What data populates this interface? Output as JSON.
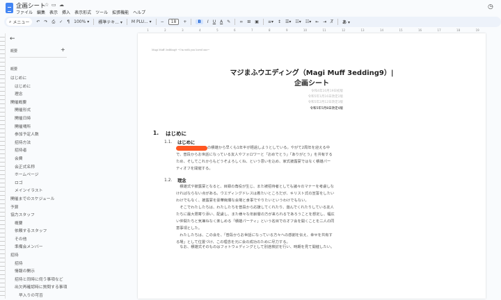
{
  "app": {
    "title": "企画シート",
    "menus": [
      "ファイル",
      "編集",
      "表示",
      "挿入",
      "表示形式",
      "ツール",
      "拡張機能",
      "ヘルプ"
    ]
  },
  "toolbar": {
    "search": "メニュー",
    "zoom": "100%",
    "style": "標準テキ...",
    "font": "M PLU...",
    "font_size": "18",
    "bold": "B",
    "italic": "I",
    "underline": "U",
    "text_color": "A",
    "input_tools": "あ"
  },
  "ruler": [
    "1",
    "2",
    "3",
    "4",
    "5",
    "6",
    "7",
    "8",
    "9",
    "10",
    "11",
    "12",
    "13",
    "14",
    "15",
    "16",
    "17",
    "18",
    "19"
  ],
  "sidebar": {
    "title": "概要",
    "outline_label": "概要",
    "items": [
      {
        "label": "はじめに",
        "level": 1
      },
      {
        "label": "はじめに",
        "level": 2
      },
      {
        "label": "理念",
        "level": 2
      },
      {
        "label": "開催概要",
        "level": 1
      },
      {
        "label": "開催形式",
        "level": 2
      },
      {
        "label": "開催日時",
        "level": 2
      },
      {
        "label": "開催場所",
        "level": 2
      },
      {
        "label": "参加予定人数",
        "level": 2
      },
      {
        "label": "招待方法",
        "level": 2
      },
      {
        "label": "招待者",
        "level": 2
      },
      {
        "label": "会費",
        "level": 2
      },
      {
        "label": "会正式名称",
        "level": 2
      },
      {
        "label": "ホームページ",
        "level": 2
      },
      {
        "label": "ロゴ",
        "level": 2
      },
      {
        "label": "メインイラスト",
        "level": 2
      },
      {
        "label": "開催までのスケジュール",
        "level": 1
      },
      {
        "label": "予算",
        "level": 1
      },
      {
        "label": "協力スタッフ",
        "level": 1
      },
      {
        "label": "概要",
        "level": 2
      },
      {
        "label": "依頼するスタッフ",
        "level": 2
      },
      {
        "label": "その他",
        "level": 2
      },
      {
        "label": "準備会メンバー",
        "level": 2
      },
      {
        "label": "招待",
        "level": 1
      },
      {
        "label": "招待",
        "level": 2
      },
      {
        "label": "情報の開示",
        "level": 2
      },
      {
        "label": "招待と同時に伺う事項など",
        "level": 2
      },
      {
        "label": "出欠再確認時に質問する事項",
        "level": 2
      },
      {
        "label": "早入りの可否",
        "level": 3
      }
    ]
  },
  "doc": {
    "header": "Magi Muff 3edding9 ~I'm with you loved one~",
    "title1": "マジまふウエディング（Magi Muff 3edding9）|",
    "title2": "企画シート",
    "dates": [
      "令和4年10月19日初版",
      "令和5年1月16日改定2版",
      "令和5年2月12日改定3版",
      "令和5年5月8日改定4版"
    ],
    "s1_num": "1.",
    "s1": "はじめに",
    "s11_num": "1.1.",
    "s11": "はじめに",
    "s11_lines": [
      "の積雄から早くも1年半が経過しようとしている。やがて2周年を迎える中",
      "で、普段からお世話になっている友人やフォロワーと「おめでとう」「ありがとう」を共有する",
      "ため、そしてこれからもどうぞよろしくね、という思いを込め、家式披露宴ではなく積雄パー",
      "ティオフを開催する。"
    ],
    "s12_num": "1.2.",
    "s12": "理念",
    "s12_lines": [
      "　積雄式や披露宴となると、目録の角役が生じ、また被招待者としても諸々のマナーを考慮しな",
      "ければならない点がある。ウエディングドレスは着たいところだが、キリスト式の宣誓をしたい",
      "わけでもなく、披露宴を豪華絢爛な会場と食事でやりたいというわけでもない。",
      "　そこでわたしたちは、わたしたちを普段から応援してくれたり、遊んでくれたりしている友人",
      "たちに最大限寄り添い、配慮し、また様々な年齢層の方が来られるであろうことを想定し、幅広",
      "い仲間たちと気兼ねなく楽しめる「積雄パーティ」という名目でのオフ会を開くことを二人の同",
      "意事項とした。",
      "　わたしたちは、この会を、「普段からお世話になっている方々への感謝を伝え、幸せを共有す",
      "る場」として位置づけ、この理念を元に会の成功のために尽力する。"
    ],
    "s12_note": "　なお、積雄式そのものはフォトウェディングとして別途検討を行い、時期を見て開催したい。"
  }
}
